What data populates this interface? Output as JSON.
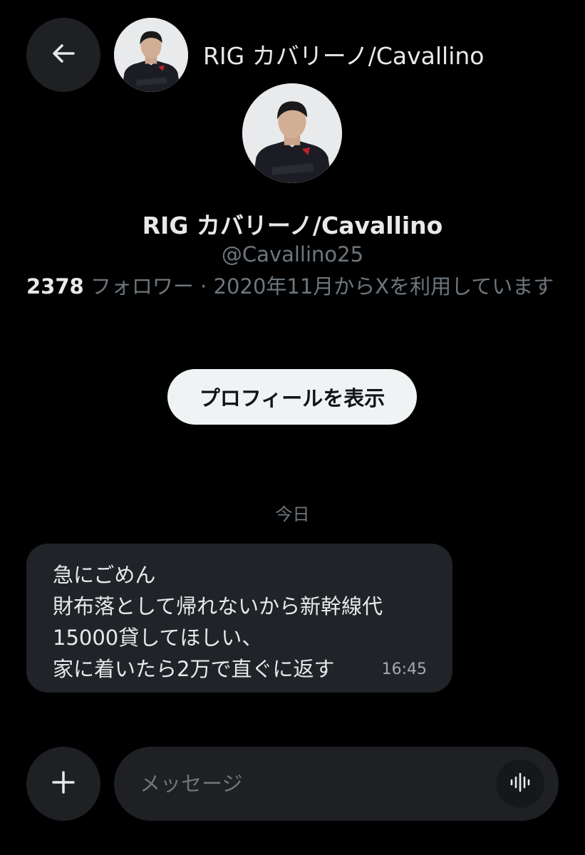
{
  "colors": {
    "background": "#000000",
    "surface": "#1f2023",
    "bubble": "#202327",
    "primary_text": "#e7e9ea",
    "secondary_text": "#6e767d",
    "button_bg": "#eff3f4",
    "button_text": "#0f1419",
    "jersey_accent": "#c0202a"
  },
  "header": {
    "back_icon": "arrow-left-icon",
    "avatar_icon": "user-avatar",
    "title": "RIG カバリーノ/Cavallino"
  },
  "profile": {
    "name": "RIG カバリーノ/Cavallino",
    "handle": "@Cavallino25",
    "followers_count": "2378",
    "meta_text": " フォロワー · 2020年11月からXを利用しています",
    "view_profile_label": "プロフィールを表示"
  },
  "conversation": {
    "date_separator": "今日",
    "messages": [
      {
        "lines": [
          "急にごめん",
          "財布落として帰れないから新幹線代",
          "15000貸してほしい、",
          "家に着いたら2万で直ぐに返す"
        ],
        "time": "16:45"
      }
    ]
  },
  "composer": {
    "add_icon": "plus-icon",
    "placeholder": "メッセージ",
    "voice_icon": "voice-waveform-icon"
  }
}
